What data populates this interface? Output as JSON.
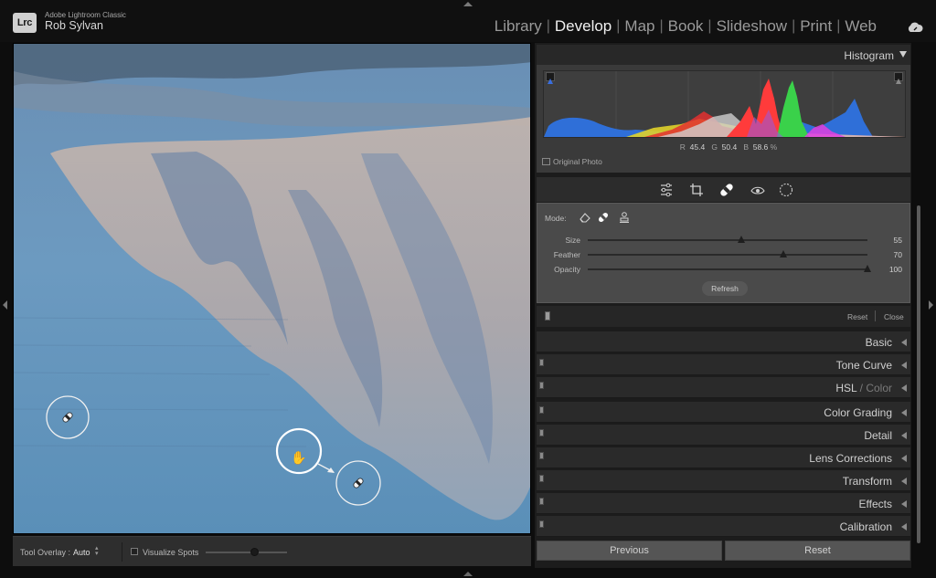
{
  "app": {
    "name": "Adobe Lightroom Classic",
    "logo": "Lrc",
    "user": "Rob Sylvan"
  },
  "modules": [
    {
      "label": "Library",
      "active": false
    },
    {
      "label": "Develop",
      "active": true
    },
    {
      "label": "Map",
      "active": false
    },
    {
      "label": "Book",
      "active": false
    },
    {
      "label": "Slideshow",
      "active": false
    },
    {
      "label": "Print",
      "active": false
    },
    {
      "label": "Web",
      "active": false
    }
  ],
  "histogram": {
    "title": "Histogram",
    "r_label": "R",
    "r_value": "45.4",
    "g_label": "G",
    "g_value": "50.4",
    "b_label": "B",
    "b_value": "58.6",
    "unit": "%",
    "original_photo": "Original Photo"
  },
  "heal": {
    "mode_label": "Mode:",
    "sliders": [
      {
        "label": "Size",
        "value": "55",
        "level": 0.55
      },
      {
        "label": "Feather",
        "value": "70",
        "level": 0.7
      },
      {
        "label": "Opacity",
        "value": "100",
        "level": 1.0
      }
    ],
    "refresh": "Refresh",
    "reset": "Reset",
    "close": "Close"
  },
  "sections": [
    {
      "label": "Basic",
      "suffix": "",
      "has_toggle": false
    },
    {
      "label": "Tone Curve",
      "suffix": "",
      "has_toggle": true
    },
    {
      "label": "HSL",
      "suffix": "Color",
      "has_toggle": true
    },
    {
      "label": "Color Grading",
      "suffix": "",
      "has_toggle": true
    },
    {
      "label": "Detail",
      "suffix": "",
      "has_toggle": true
    },
    {
      "label": "Lens Corrections",
      "suffix": "",
      "has_toggle": true
    },
    {
      "label": "Transform",
      "suffix": "",
      "has_toggle": true
    },
    {
      "label": "Effects",
      "suffix": "",
      "has_toggle": true
    },
    {
      "label": "Calibration",
      "suffix": "",
      "has_toggle": true
    }
  ],
  "bottom": {
    "previous": "Previous",
    "reset": "Reset"
  },
  "toolbar": {
    "tool_overlay_label": "Tool Overlay :",
    "tool_overlay_value": "Auto",
    "visualize_spots": "Visualize Spots",
    "visualize_level": 0.6
  }
}
